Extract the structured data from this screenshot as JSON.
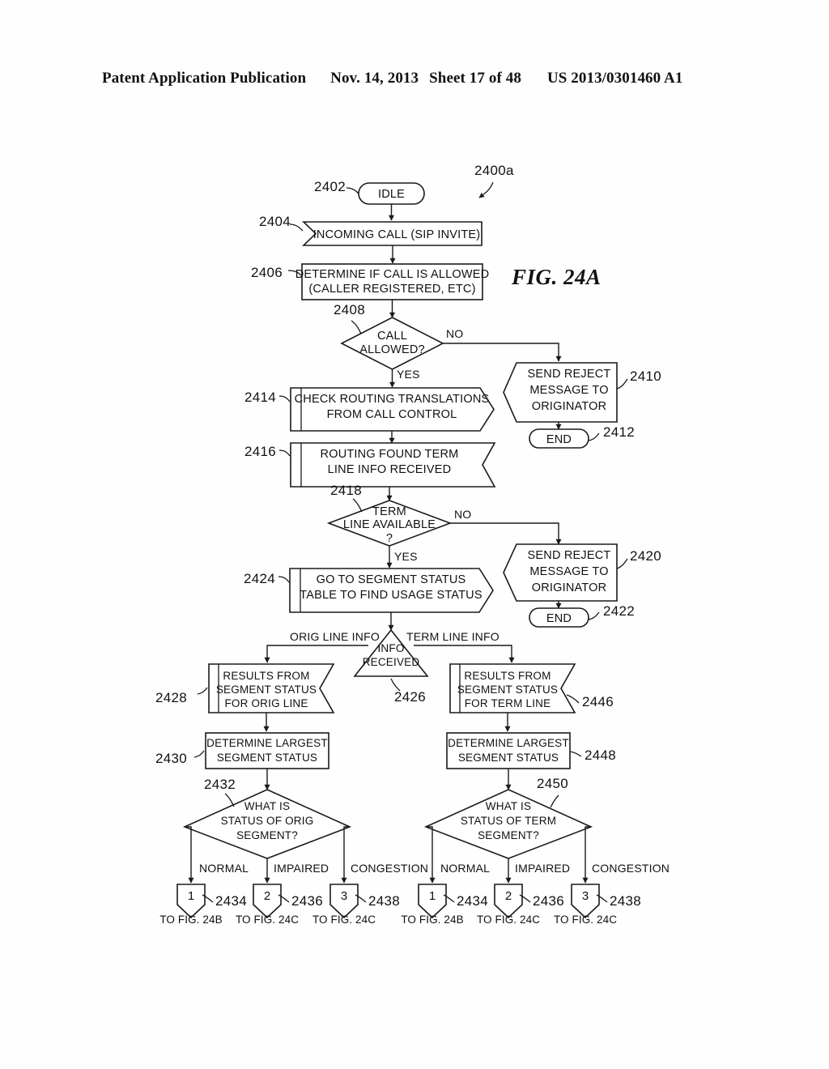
{
  "header": {
    "left": "Patent Application Publication",
    "date": "Nov. 14, 2013",
    "sheet": "Sheet 17 of 48",
    "docnum": "US 2013/0301460 A1"
  },
  "figure": {
    "label": "FIG. 24A",
    "diagram_ref": "2400a"
  },
  "nodes": {
    "idle": {
      "ref": "2402",
      "text": "IDLE"
    },
    "incoming": {
      "ref": "2404",
      "text": "INCOMING CALL (SIP INVITE)"
    },
    "determine_allowed": {
      "ref": "2406",
      "line1": "DETERMINE IF CALL IS ALLOWED",
      "line2": "(CALLER REGISTERED, ETC)"
    },
    "call_allowed": {
      "ref": "2408",
      "line1": "CALL",
      "line2": "ALLOWED?"
    },
    "reject1": {
      "ref": "2410",
      "line1": "SEND REJECT",
      "line2": "MESSAGE TO",
      "line3": "ORIGINATOR"
    },
    "end1": {
      "ref": "2412",
      "text": "END"
    },
    "check_routing": {
      "ref": "2414",
      "line1": "CHECK ROUTING TRANSLATIONS",
      "line2": "FROM CALL CONTROL"
    },
    "routing_found": {
      "ref": "2416",
      "line1": "ROUTING FOUND TERM",
      "line2": "LINE INFO RECEIVED"
    },
    "term_avail": {
      "ref": "2418",
      "line1": "TERM",
      "line2": "LINE AVAILABLE",
      "line3": "?"
    },
    "reject2": {
      "ref": "2420",
      "line1": "SEND REJECT",
      "line2": "MESSAGE TO",
      "line3": "ORIGINATOR"
    },
    "end2": {
      "ref": "2422",
      "text": "END"
    },
    "goto_segment": {
      "ref": "2424",
      "line1": "GO TO SEGMENT STATUS",
      "line2": "TABLE TO FIND USAGE STATUS"
    },
    "info_received": {
      "ref": "2426",
      "line1": "INFO",
      "line2": "RECEIVED"
    },
    "results_orig": {
      "ref": "2428",
      "line1": "RESULTS FROM",
      "line2": "SEGMENT STATUS",
      "line3": "FOR ORIG LINE"
    },
    "largest_orig": {
      "ref": "2430",
      "line1": "DETERMINE LARGEST",
      "line2": "SEGMENT STATUS"
    },
    "status_orig": {
      "ref": "2432",
      "line1": "WHAT IS",
      "line2": "STATUS OF ORIG",
      "line3": "SEGMENT?"
    },
    "results_term": {
      "ref": "2446",
      "line1": "RESULTS FROM",
      "line2": "SEGMENT STATUS",
      "line3": "FOR TERM LINE"
    },
    "largest_term": {
      "ref": "2448",
      "line1": "DETERMINE LARGEST",
      "line2": "SEGMENT STATUS"
    },
    "status_term": {
      "ref": "2450",
      "line1": "WHAT IS",
      "line2": "STATUS OF TERM",
      "line3": "SEGMENT?"
    }
  },
  "edge_labels": {
    "no1": "NO",
    "yes1": "YES",
    "no2": "NO",
    "yes2": "YES",
    "orig_line_info": "ORIG LINE INFO",
    "term_line_info": "TERM LINE INFO",
    "normal": "NORMAL",
    "impaired": "IMPAIRED",
    "congestion": "CONGESTION"
  },
  "connectors": {
    "orig": [
      {
        "num": "1",
        "ref": "2434",
        "target": "TO FIG. 24B",
        "branch": "NORMAL"
      },
      {
        "num": "2",
        "ref": "2436",
        "target": "TO FIG. 24C",
        "branch": "IMPAIRED"
      },
      {
        "num": "3",
        "ref": "2438",
        "target": "TO FIG. 24C",
        "branch": "CONGESTION"
      }
    ],
    "term": [
      {
        "num": "1",
        "ref": "2434",
        "target": "TO FIG. 24B",
        "branch": "NORMAL"
      },
      {
        "num": "2",
        "ref": "2436",
        "target": "TO FIG. 24C",
        "branch": "IMPAIRED"
      },
      {
        "num": "3",
        "ref": "2438",
        "target": "TO FIG. 24C",
        "branch": "CONGESTION"
      }
    ]
  },
  "colors": {
    "ink": "#1a1a1a",
    "paper": "#ffffff"
  }
}
